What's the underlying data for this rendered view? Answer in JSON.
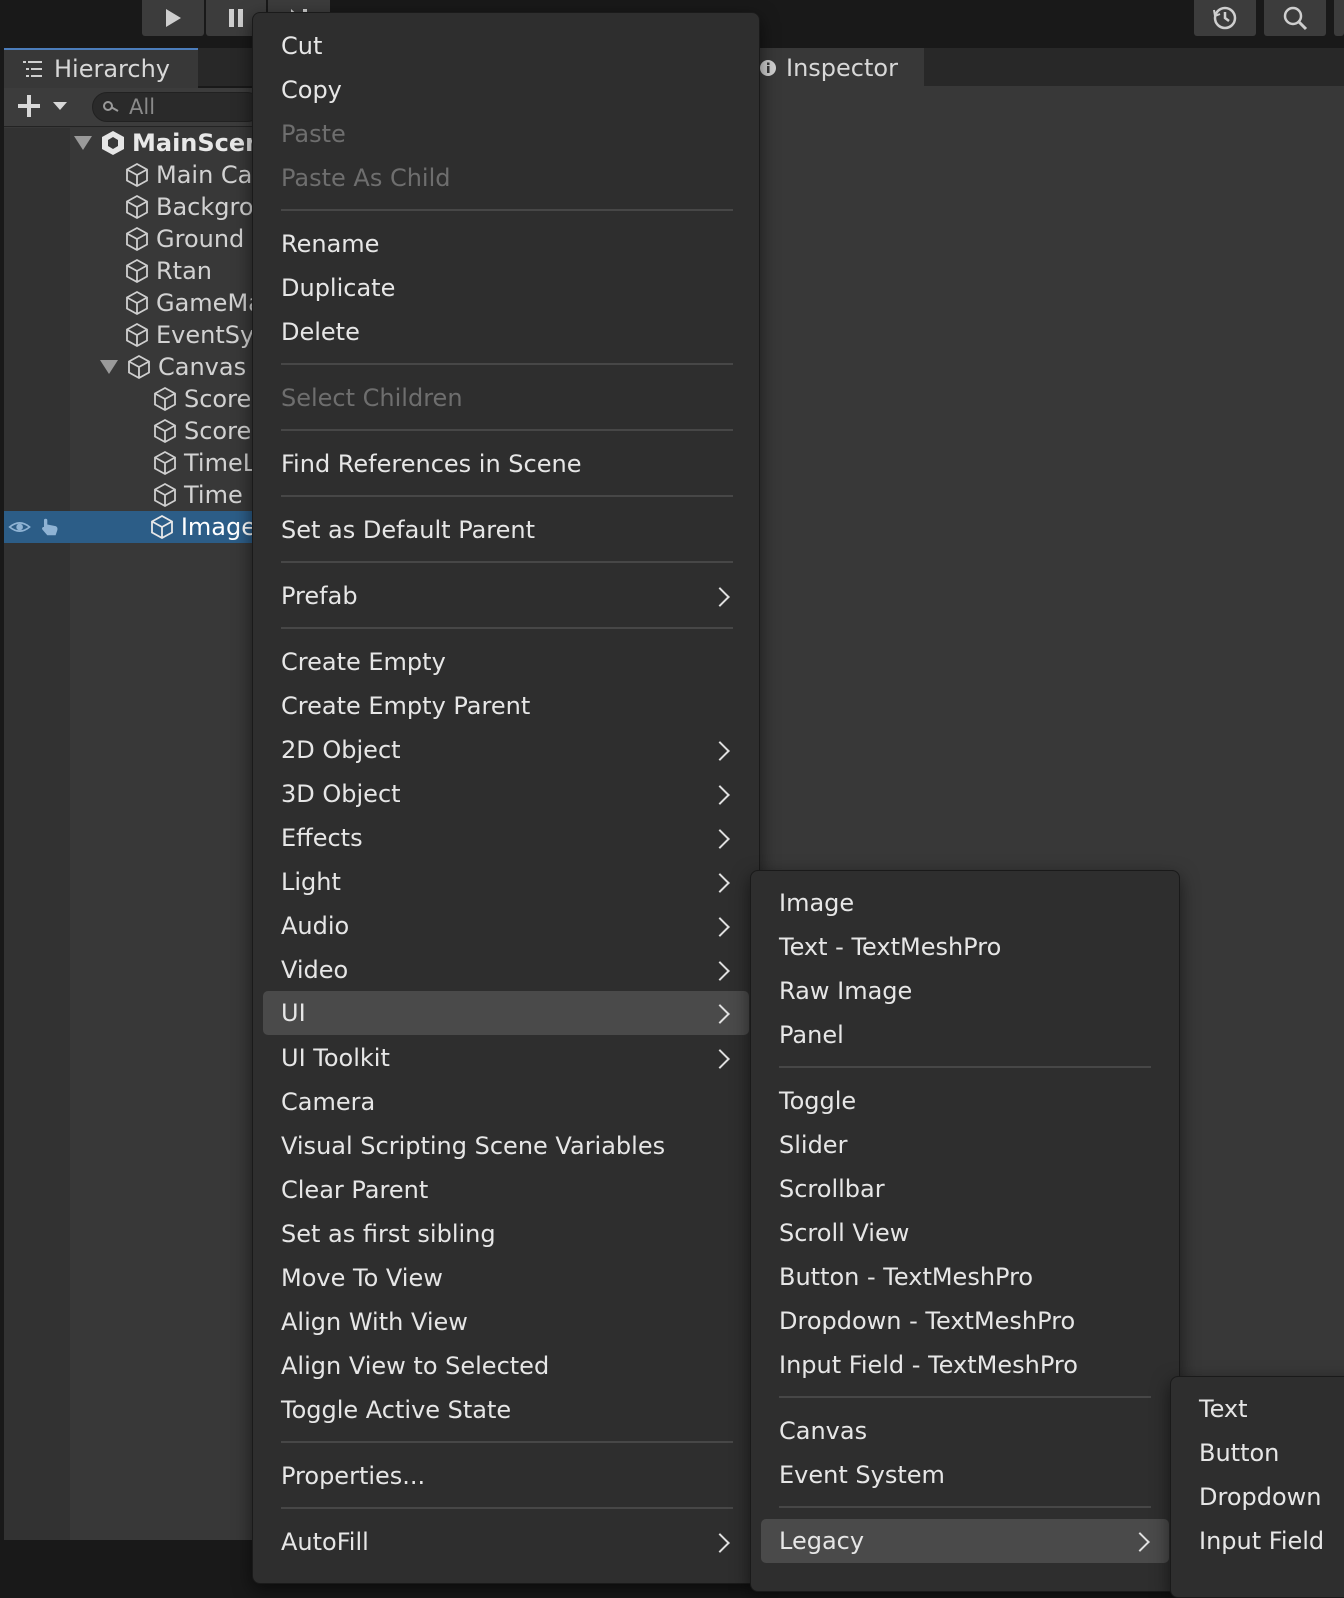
{
  "colors": {
    "background": "#191919",
    "panel": "#383838",
    "menu": "#2e2e2e",
    "selection": "#2c5d87",
    "highlight": "#4a4a4a",
    "disabled_text": "#6e6e6e"
  },
  "toolbar": {
    "play_icon": "play-icon",
    "pause_icon": "pause-icon",
    "step_icon": "step-icon",
    "history_icon": "history-icon",
    "search_icon": "search-icon"
  },
  "hierarchy": {
    "tab_label": "Hierarchy",
    "search_placeholder": "All",
    "rows": [
      {
        "label": "MainScene"
      },
      {
        "label": "Main Camera"
      },
      {
        "label": "Background"
      },
      {
        "label": "Ground"
      },
      {
        "label": "Rtan"
      },
      {
        "label": "GameManager"
      },
      {
        "label": "EventSystem"
      },
      {
        "label": "Canvas"
      },
      {
        "label": "Score"
      },
      {
        "label": "Score"
      },
      {
        "label": "TimeLabel"
      },
      {
        "label": "Time"
      },
      {
        "label": "Image"
      }
    ]
  },
  "inspector": {
    "tab_label": "Inspector"
  },
  "context_menu": {
    "items": {
      "cut": "Cut",
      "copy": "Copy",
      "paste": "Paste",
      "paste_as_child": "Paste As Child",
      "rename": "Rename",
      "duplicate": "Duplicate",
      "delete": "Delete",
      "select_children": "Select Children",
      "find_references": "Find References in Scene",
      "set_default_parent": "Set as Default Parent",
      "prefab": "Prefab",
      "create_empty": "Create Empty",
      "create_empty_parent": "Create Empty Parent",
      "object_2d": "2D Object",
      "object_3d": "3D Object",
      "effects": "Effects",
      "light": "Light",
      "audio": "Audio",
      "video": "Video",
      "ui": "UI",
      "ui_toolkit": "UI Toolkit",
      "camera": "Camera",
      "visual_scripting": "Visual Scripting Scene Variables",
      "clear_parent": "Clear Parent",
      "set_first_sibling": "Set as first sibling",
      "move_to_view": "Move To View",
      "align_with_view": "Align With View",
      "align_view_to_selected": "Align View to Selected",
      "toggle_active_state": "Toggle Active State",
      "properties": "Properties...",
      "autofill": "AutoFill"
    }
  },
  "ui_submenu": {
    "items": {
      "image": "Image",
      "text_tmp": "Text - TextMeshPro",
      "raw_image": "Raw Image",
      "panel": "Panel",
      "toggle": "Toggle",
      "slider": "Slider",
      "scrollbar": "Scrollbar",
      "scroll_view": "Scroll View",
      "button_tmp": "Button - TextMeshPro",
      "dropdown_tmp": "Dropdown - TextMeshPro",
      "input_field_tmp": "Input Field - TextMeshPro",
      "canvas": "Canvas",
      "event_system": "Event System",
      "legacy": "Legacy"
    }
  },
  "legacy_submenu": {
    "items": {
      "text": "Text",
      "button": "Button",
      "dropdown": "Dropdown",
      "input_field": "Input Field"
    }
  }
}
